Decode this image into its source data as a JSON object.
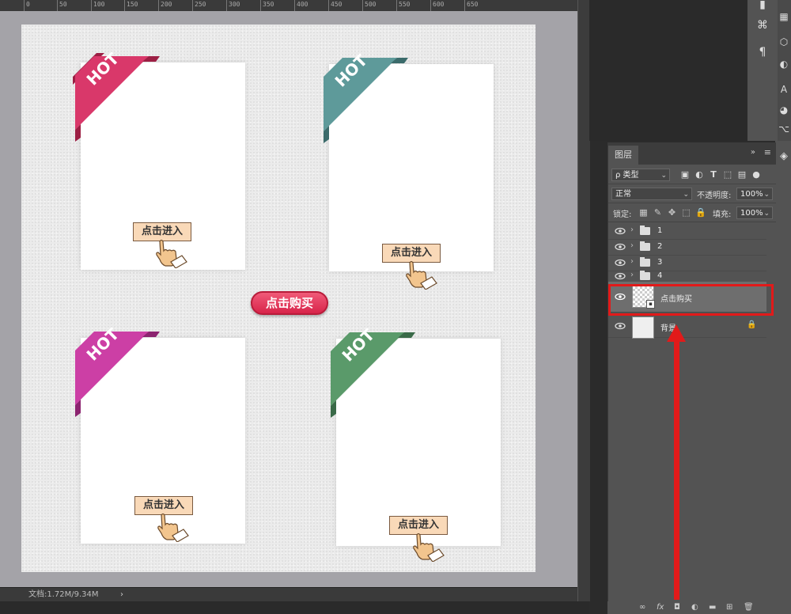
{
  "ruler": {
    "ticks": [
      "0",
      "50",
      "100",
      "150",
      "200",
      "250",
      "300",
      "350",
      "400",
      "450",
      "500",
      "550",
      "600",
      "650"
    ]
  },
  "canvas": {
    "cards": [
      {
        "ribbon_text": "HOT",
        "ribbon_color": "#d9386a",
        "button_label": "点击进入"
      },
      {
        "ribbon_text": "HOT",
        "ribbon_color": "#5e9a9a",
        "button_label": "点击进入"
      },
      {
        "ribbon_text": "HOT",
        "ribbon_color": "#cc3fa5",
        "button_label": "点击进入"
      },
      {
        "ribbon_text": "HOT",
        "ribbon_color": "#5a9a6a",
        "button_label": "点击进入"
      }
    ],
    "buy_button_label": "点击购买",
    "buy_button_color": "#e03358"
  },
  "status": {
    "doc_info": "文档:1.72M/9.34M",
    "arrow": "›"
  },
  "right_toolbar": {
    "icons": [
      "tool-preset-icon",
      "paragraph-style-icon",
      "paragraph-icon",
      "character-icon",
      "adjust-icon",
      "3d-icon",
      "layers-icon"
    ]
  },
  "layers_panel": {
    "tab_label": "图层",
    "collapse": "»",
    "filter": {
      "label": "类型",
      "search_symbol": "ρ"
    },
    "blend_mode": "正常",
    "opacity_label": "不透明度:",
    "opacity_value": "100%",
    "lock_label": "锁定:",
    "fill_label": "填充:",
    "fill_value": "100%",
    "groups": [
      {
        "name": "1"
      },
      {
        "name": "2"
      },
      {
        "name": "3"
      },
      {
        "name": "4"
      }
    ],
    "smart_layer_name": "点击购买",
    "background_layer_name": "背景",
    "bottom_icons": [
      "link-icon",
      "fx-icon",
      "mask-icon",
      "adjustment-icon",
      "new-group-icon",
      "new-layer-icon",
      "delete-icon"
    ],
    "bottom_labels": {
      "fx": "fx"
    }
  },
  "annotation": {
    "highlight_color": "#e21a1a"
  }
}
